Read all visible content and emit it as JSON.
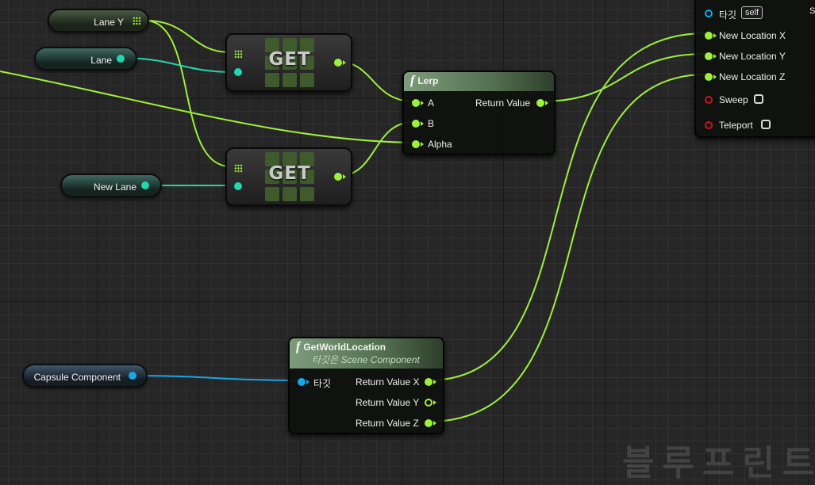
{
  "variables": {
    "lane_y": "Lane Y",
    "lane": "Lane",
    "new_lane": "New Lane",
    "capsule_component": "Capsule Component"
  },
  "get_nodes": {
    "label": "GET"
  },
  "lerp": {
    "title": "Lerp",
    "pin_a": "A",
    "pin_b": "B",
    "pin_alpha": "Alpha",
    "return_value": "Return Value"
  },
  "get_world_location": {
    "title": "GetWorldLocation",
    "subtitle": "타깃은 Scene Component",
    "target": "타깃",
    "return_x": "Return Value X",
    "return_y": "Return Value Y",
    "return_z": "Return Value Z"
  },
  "set_location": {
    "target": "타깃",
    "self_label": "self",
    "new_location_x": "New Location X",
    "new_location_y": "New Location Y",
    "new_location_z": "New Location Z",
    "sweep": "Sweep",
    "teleport": "Teleport",
    "cut_off_text": "S"
  },
  "watermark": "블루프린트",
  "colors": {
    "float_pin": "#9ef03a",
    "int_pin": "#22d6b0",
    "object_pin": "#1aa5e6",
    "bool_pin": "#c8141c",
    "graph_bg": "#262626"
  }
}
